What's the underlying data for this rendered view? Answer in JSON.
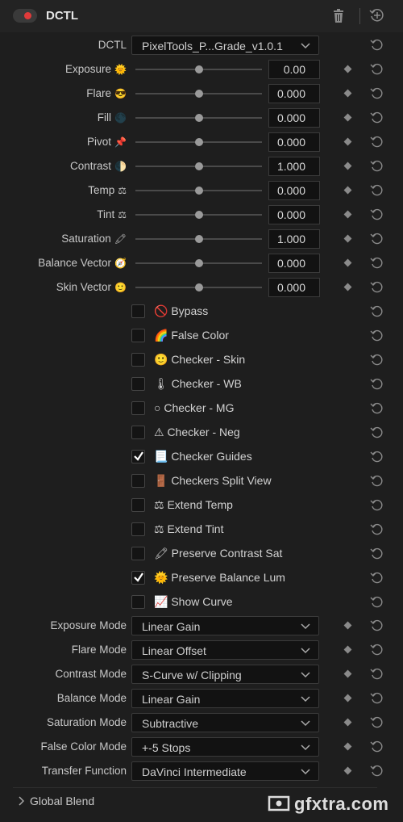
{
  "header": {
    "title": "DCTL",
    "enabled": true
  },
  "dctl_select": {
    "label": "DCTL",
    "value": "PixelTools_P...Grade_v1.0.1"
  },
  "sliders": [
    {
      "label": "Exposure",
      "emoji": "🌞",
      "value": "0.00",
      "level": 0.5
    },
    {
      "label": "Flare",
      "emoji": "😎",
      "value": "0.000",
      "level": 0.5
    },
    {
      "label": "Fill",
      "emoji": "🌑",
      "value": "0.000",
      "level": 0.5
    },
    {
      "label": "Pivot",
      "emoji": "📌",
      "value": "0.000",
      "level": 0.5
    },
    {
      "label": "Contrast",
      "emoji": "🌓",
      "value": "1.000",
      "level": 0.5
    },
    {
      "label": "Temp",
      "emoji": "⚖",
      "value": "0.000",
      "level": 0.5
    },
    {
      "label": "Tint",
      "emoji": "⚖",
      "value": "0.000",
      "level": 0.5
    },
    {
      "label": "Saturation",
      "emoji": "🖍",
      "value": "1.000",
      "level": 0.5
    },
    {
      "label": "Balance Vector",
      "emoji": "🧭",
      "value": "0.000",
      "level": 0.5
    },
    {
      "label": "Skin Vector",
      "emoji": "🙂",
      "value": "0.000",
      "level": 0.5
    }
  ],
  "checkboxes": [
    {
      "label": "🚫 Bypass",
      "checked": false
    },
    {
      "label": "🌈 False Color",
      "checked": false
    },
    {
      "label": "🙂 Checker - Skin",
      "checked": false
    },
    {
      "label": "🌡 Checker - WB",
      "checked": false
    },
    {
      "label": "○ Checker - MG",
      "checked": false
    },
    {
      "label": "⚠ Checker - Neg",
      "checked": false
    },
    {
      "label": "📃 Checker Guides",
      "checked": true
    },
    {
      "label": "🚪 Checkers Split View",
      "checked": false
    },
    {
      "label": "⚖ Extend Temp",
      "checked": false
    },
    {
      "label": "⚖ Extend Tint",
      "checked": false
    },
    {
      "label": "🖍 Preserve Contrast Sat",
      "checked": false
    },
    {
      "label": "🌞 Preserve Balance Lum",
      "checked": true
    },
    {
      "label": "📈 Show Curve",
      "checked": false
    }
  ],
  "modes": [
    {
      "label": "Exposure Mode",
      "value": "Linear Gain"
    },
    {
      "label": "Flare Mode",
      "value": "Linear Offset"
    },
    {
      "label": "Contrast Mode",
      "value": "S-Curve w/ Clipping"
    },
    {
      "label": "Balance Mode",
      "value": "Linear Gain"
    },
    {
      "label": "Saturation Mode",
      "value": "Subtractive"
    },
    {
      "label": "False Color Mode",
      "value": "+-5 Stops"
    },
    {
      "label": "Transfer Function",
      "value": "DaVinci Intermediate"
    }
  ],
  "footer": {
    "title": "Global Blend"
  },
  "watermark": {
    "text": "gfxtra.com"
  },
  "colors": {
    "toggle_on": "#e03a3a",
    "panel_bg": "#1e1e1e",
    "field_bg": "#121212"
  },
  "icons": {
    "trash": "trash-icon",
    "reset": "reset-icon",
    "add_reset": "add-reset-icon",
    "chevron": "chevron-down-icon",
    "keyframe": "keyframe-diamond-icon"
  }
}
